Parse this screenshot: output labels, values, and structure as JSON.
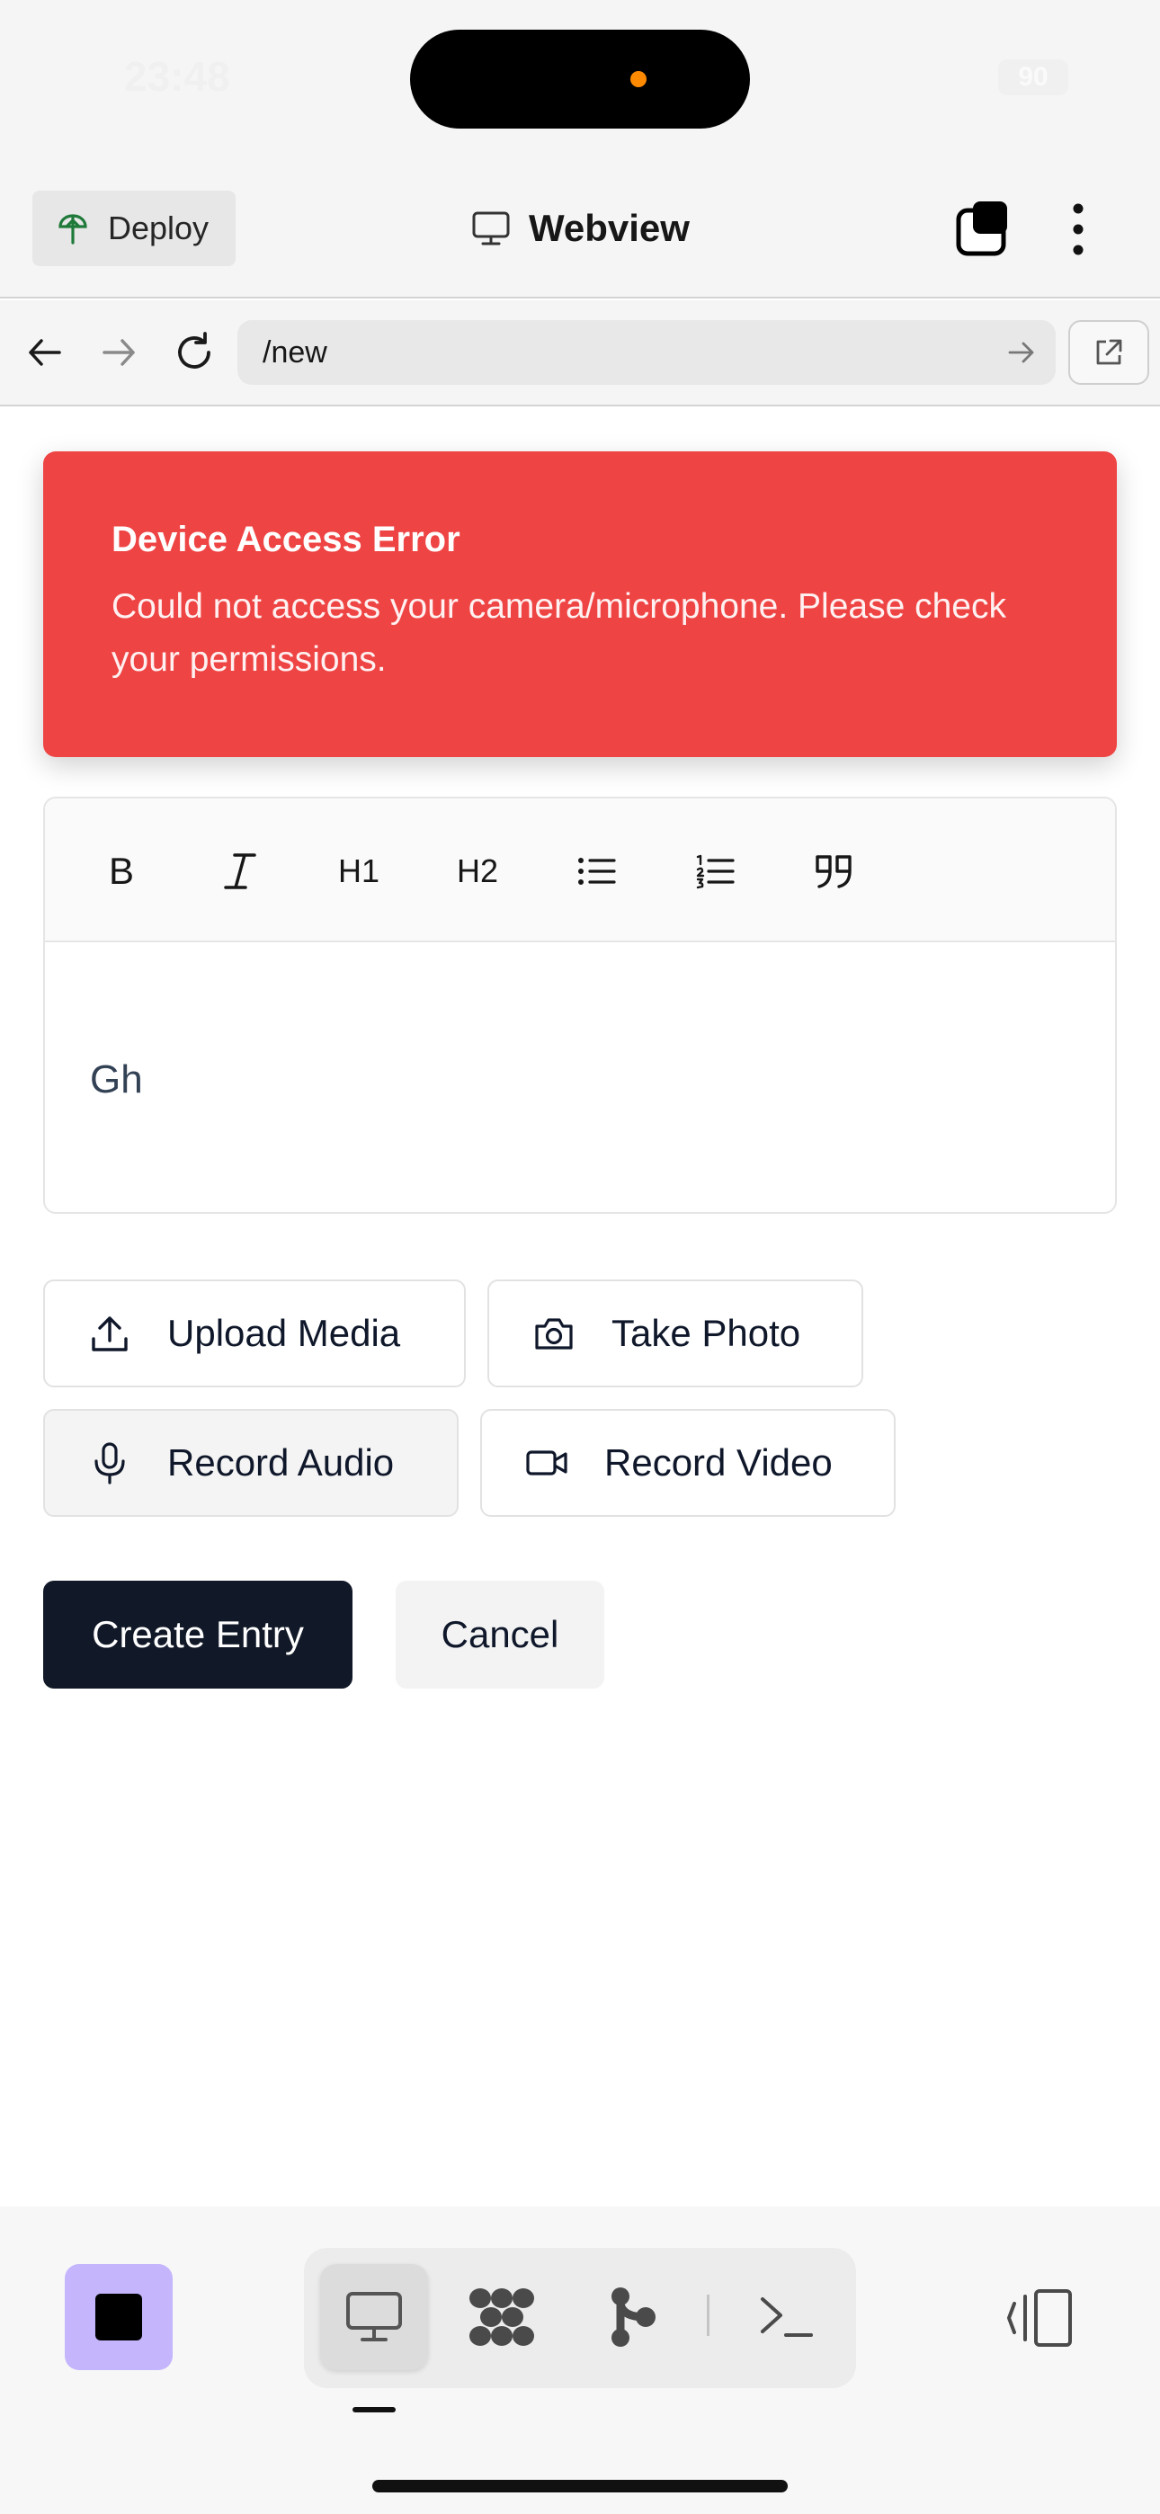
{
  "status_bar": {
    "time": "23:48",
    "battery": "90"
  },
  "top_bar": {
    "deploy_label": "Deploy",
    "title": "Webview"
  },
  "url_bar": {
    "url": "/new"
  },
  "toast": {
    "title": "Device Access Error",
    "message": "Could not access your camera/microphone. Please check your permissions."
  },
  "editor": {
    "toolbar": {
      "bold": "B",
      "italic": "I",
      "h1": "H1",
      "h2": "H2"
    },
    "content": "Gh"
  },
  "media_buttons": {
    "upload": "Upload Media",
    "photo": "Take Photo",
    "audio": "Record Audio",
    "video": "Record Video"
  },
  "actions": {
    "create": "Create Entry",
    "cancel": "Cancel"
  },
  "colors": {
    "error": "#ef4444",
    "primary": "#111827",
    "stop_button": "#c4b5fd"
  }
}
